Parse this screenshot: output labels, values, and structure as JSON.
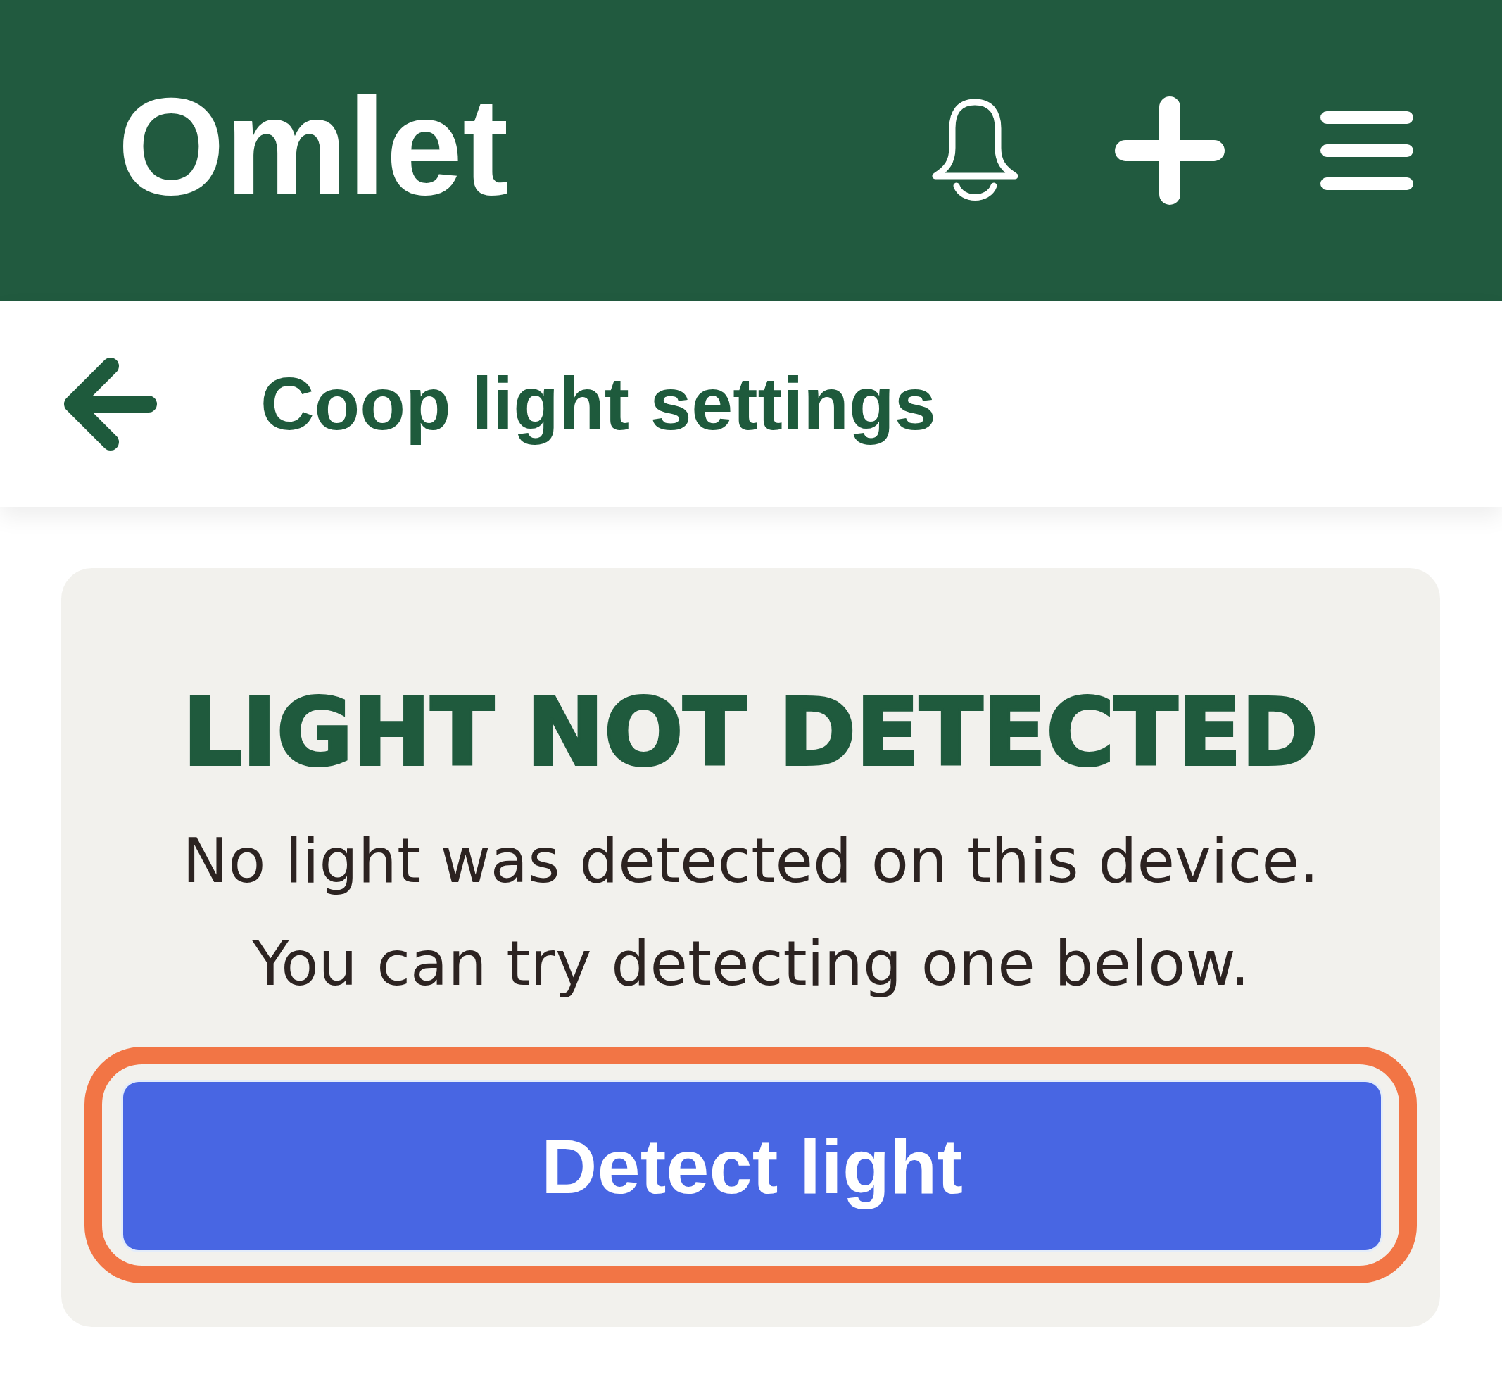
{
  "header": {
    "logo": "Omlet"
  },
  "page_header": {
    "title": "Coop light settings"
  },
  "notice": {
    "heading": "LIGHT NOT DETECTED",
    "lines": [
      "No light was detected on this device.",
      "You can try detecting one below."
    ],
    "button": {
      "label": "Detect light",
      "highlighted": true
    }
  }
}
